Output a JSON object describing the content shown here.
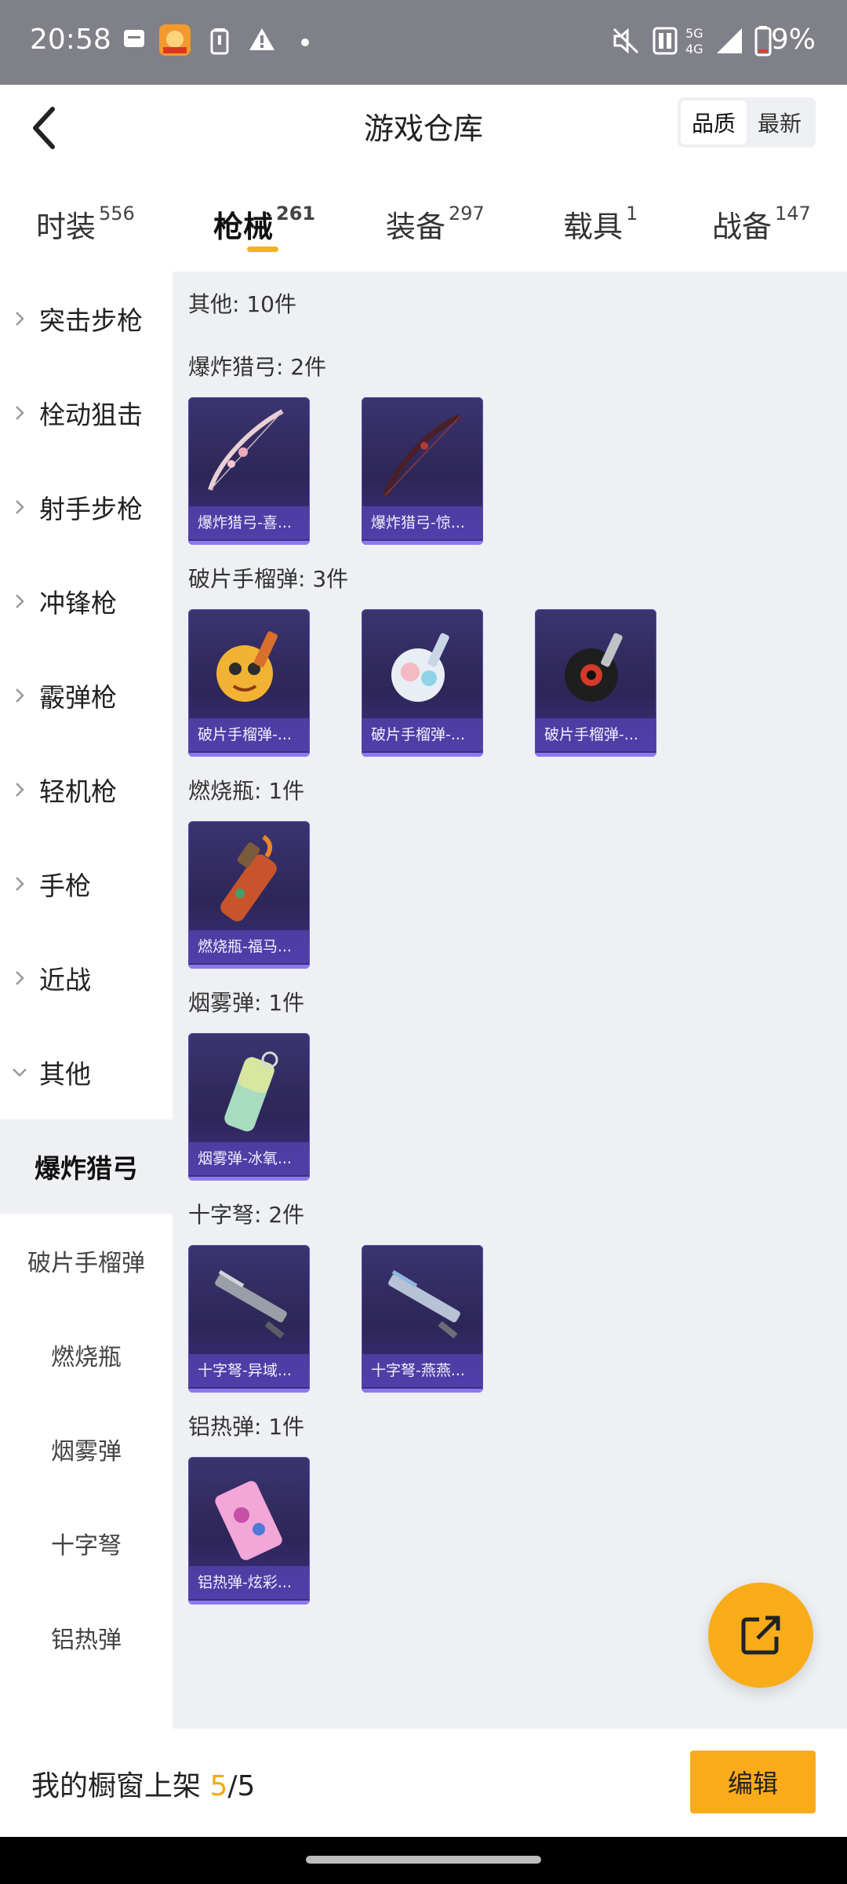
{
  "status_bar": {
    "time": "20:58",
    "battery": "9%",
    "icons": [
      "message-icon",
      "app-icon",
      "battery-saver-icon",
      "warning-icon",
      "dot-icon",
      "mute-icon",
      "nfc-icon",
      "network-5g-4g-icon",
      "signal-icon",
      "battery-low-icon"
    ]
  },
  "header": {
    "title": "游戏仓库",
    "sort": {
      "quality": "品质",
      "latest": "最新"
    }
  },
  "tabs": [
    {
      "label": "时装",
      "count": "556"
    },
    {
      "label": "枪械",
      "count": "261"
    },
    {
      "label": "装备",
      "count": "297"
    },
    {
      "label": "载具",
      "count": "1"
    },
    {
      "label": "战备",
      "count": "147"
    }
  ],
  "sidebar": {
    "categories": [
      "突击步枪",
      "栓动狙击",
      "射手步枪",
      "冲锋枪",
      "霰弹枪",
      "轻机枪",
      "手枪",
      "近战",
      "其他"
    ],
    "subitems": [
      "爆炸猎弓",
      "破片手榴弹",
      "燃烧瓶",
      "烟雾弹",
      "十字弩",
      "铝热弹"
    ]
  },
  "content": {
    "summary": "其他: 10件",
    "sections": [
      {
        "title": "爆炸猎弓: 2件",
        "items": [
          "爆炸猎弓-喜...",
          "爆炸猎弓-惊..."
        ]
      },
      {
        "title": "破片手榴弹: 3件",
        "items": [
          "破片手榴弹-...",
          "破片手榴弹-...",
          "破片手榴弹-..."
        ]
      },
      {
        "title": "燃烧瓶: 1件",
        "items": [
          "燃烧瓶-福马..."
        ]
      },
      {
        "title": "烟雾弹: 1件",
        "items": [
          "烟雾弹-冰氧..."
        ]
      },
      {
        "title": "十字弩: 2件",
        "items": [
          "十字弩-异域...",
          "十字弩-燕燕..."
        ]
      },
      {
        "title": "铝热弹: 1件",
        "items": [
          "铝热弹-炫彩..."
        ]
      }
    ]
  },
  "bottom": {
    "label": "我的橱窗上架 ",
    "count": "5",
    "total": "/5",
    "edit": "编辑"
  },
  "colors": {
    "accent": "#f8ac19",
    "card": "#2d2657",
    "card_border": "#8d78f2"
  }
}
